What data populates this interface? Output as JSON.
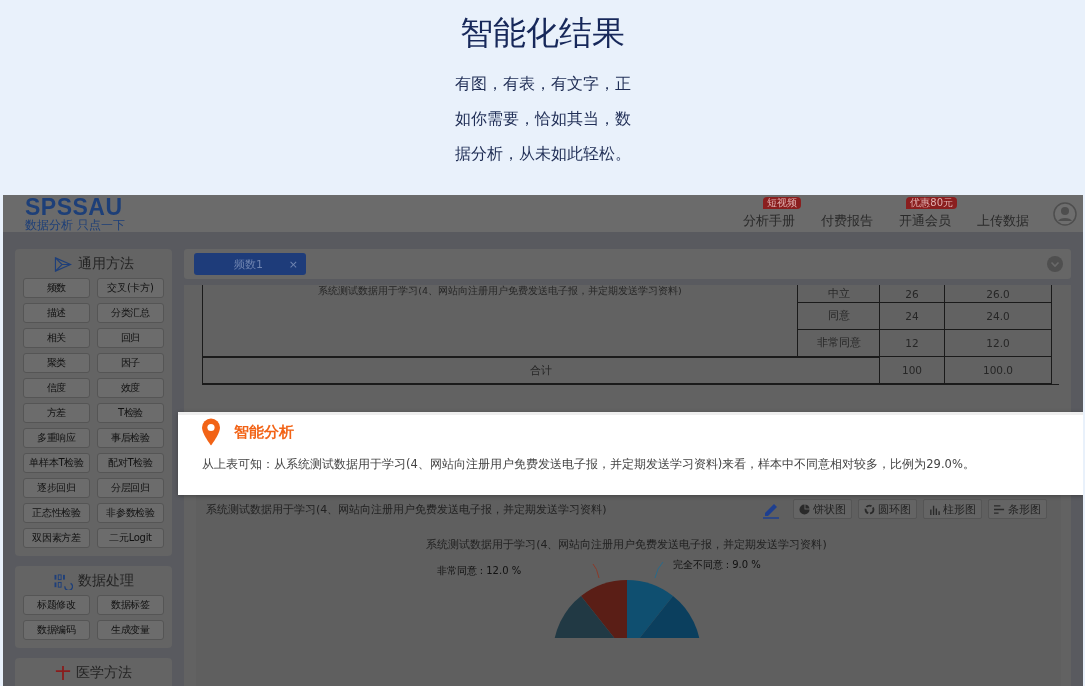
{
  "banner": {
    "title": "智能化结果",
    "lines": [
      "有图，有表，有文字，正",
      "如你需要，恰如其当，数",
      "据分析，从未如此轻松。"
    ]
  },
  "app": {
    "logo": "SPSSAU",
    "tagline": "数据分析 只点一下",
    "nav": [
      {
        "label": "分析手册",
        "badge": "短视频"
      },
      {
        "label": "付费报告"
      },
      {
        "label": "开通会员",
        "badge": "优惠80元"
      },
      {
        "label": "上传数据"
      }
    ],
    "tabs": [
      {
        "label": "频数1",
        "close": "×",
        "selected": true
      }
    ],
    "sidebar": [
      {
        "title": "通用方法",
        "kind": "network",
        "items": [
          "频数",
          "交叉(卡方)",
          "描述",
          "分类汇总",
          "相关",
          "回归",
          "聚类",
          "因子",
          "信度",
          "效度",
          "方差",
          "T检验",
          "多重响应",
          "事后检验",
          "单样本T检验",
          "配对T检验",
          "逐步回归",
          "分层回归",
          "正态性检验",
          "非参数检验",
          "双因素方差",
          "二元Logit"
        ]
      },
      {
        "title": "数据处理",
        "kind": "binary",
        "items": [
          "标题修改",
          "数据标签",
          "数据编码",
          "生成变量"
        ]
      },
      {
        "title": "医学方法",
        "kind": "cross"
      }
    ],
    "table": {
      "variable": "系统测试数据用于学习(4、网站向注册用户免费发送电子报，并定期发送学习资料)",
      "rows": [
        {
          "category": "中立",
          "count": "26",
          "percent": "26.0"
        },
        {
          "category": "同意",
          "count": "24",
          "percent": "24.0"
        },
        {
          "category": "非常同意",
          "count": "12",
          "percent": "12.0"
        }
      ],
      "total": {
        "label": "合计",
        "count": "100",
        "percent": "100.0"
      }
    },
    "analysis": {
      "title": "智能分析",
      "text": "从上表可知：从系统测试数据用于学习(4、网站向注册用户免费发送电子报，并定期发送学习资料)来看，样本中不同意相对较多，比例为29.0%。"
    },
    "chart_panel": {
      "title": "系统测试数据用于学习(4、网站向注册用户免费发送电子报，并定期发送学习资料)",
      "buttons": [
        {
          "label": "饼状图",
          "kind": "pie"
        },
        {
          "label": "圆环图",
          "kind": "ring"
        },
        {
          "label": "柱形图",
          "kind": "bars"
        },
        {
          "label": "条形图",
          "kind": "lines"
        }
      ],
      "chart_title": "系统测试数据用于学习(4、网站向注册用户免费发送电子报，并定期发送学习资料)",
      "slice_labels": [
        "非常同意 : 12.0 %",
        "完全不同意 : 9.0 %"
      ]
    }
  }
}
